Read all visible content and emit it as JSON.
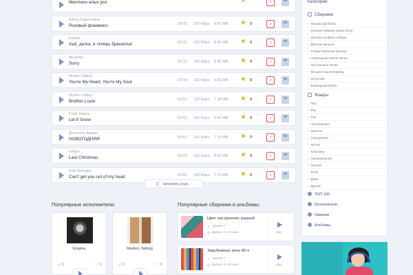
{
  "tracks": [
    {
      "artist": "",
      "title": "Меллион алых роз",
      "duration": "",
      "bitrate": "",
      "size": "",
      "likes": ""
    },
    {
      "artist": "Алина Самсоновна",
      "title": "Розовый фламинго",
      "duration": "38:08",
      "bitrate": "192 Kbps",
      "size": "8.82 MB",
      "likes": "0"
    },
    {
      "artist": "Комбат",
      "title": "Хей, детка, я теперь брюнетка!",
      "duration": "03:31",
      "bitrate": "192 Kbps",
      "size": "8.82 MB",
      "likes": "0"
    },
    {
      "artist": "Monsoha",
      "title": "Sorry",
      "duration": "03:31",
      "bitrate": "192 Kbps",
      "size": "8.82 MB",
      "likes": "0"
    },
    {
      "artist": "Modern Talking",
      "title": "You're My Heart, You're My Soul",
      "duration": "03:09",
      "bitrate": "192 Kbps",
      "size": "8.82 MB",
      "likes": "0"
    },
    {
      "artist": "Modern Talking",
      "title": "Brother Louie",
      "duration": "03:51",
      "bitrate": "192 Kbps",
      "size": "7.34 MB",
      "likes": "0"
    },
    {
      "artist": "Frank Sinatra",
      "title": "Let It Snow",
      "duration": "03:51",
      "bitrate": "192 Kbps",
      "size": "6.90 MB",
      "likes": "0"
    },
    {
      "artist": "Дискотека Авария",
      "title": "НОВОГОДНЯЯ",
      "duration": "03:51",
      "bitrate": "192 Kbps",
      "size": "7.76 MB",
      "likes": "0"
    },
    {
      "artist": "Wham!",
      "title": "Last Christmas",
      "duration": "03:09",
      "bitrate": "192 Kbps",
      "size": "8.82 MB",
      "likes": "0"
    },
    {
      "artist": "Kelly Mehugue",
      "title": "Can't get you out of my head",
      "duration": "03:51",
      "bitrate": "192 Kbps",
      "size": "7.76 MB",
      "likes": "0"
    }
  ],
  "load_more": "загрузить еще...",
  "artists_heading": "Популярные исполнители:",
  "collections_heading": "Популярные сборники и альбомы:",
  "artists": [
    {
      "name": "Enigma",
      "tracks": "3",
      "likes": "0"
    },
    {
      "name": "Modern Talking",
      "tracks": "3",
      "likes": "0"
    }
  ],
  "collections": [
    {
      "title": "Цвет настроения: разный",
      "count": "треков: 7",
      "duration": "время: 0ч 16 мин",
      "play": "play"
    },
    {
      "title": "Зарубежные хиты 80-х",
      "count": "треков: 7",
      "duration": "время: 0ч 16 мин",
      "play": "play"
    }
  ],
  "sidebar": {
    "top_label": "Категории",
    "collections_label": "Сборники",
    "collections": [
      "Музыка футбола",
      "Лучшие новинки музон 2018",
      "Музыка на День победы",
      "Детская музыка",
      "Рождественская музыка",
      "Новогодние клипы песни",
      "Застольные песни",
      "Музыка под вечеринку",
      "За рулем",
      "Баннерный вовон"
    ],
    "genres_label": "Жанры",
    "genres": [
      "Поп",
      "Рок",
      "Рэп",
      "Электроника",
      "Шансон",
      "Саундтреки",
      "Метал",
      "Классика",
      "Танцевальная",
      "Лесная",
      "R'n'B",
      "Джаз",
      "Другие"
    ],
    "links": [
      "ТОП 100",
      "Исполнители",
      "Новинки",
      "Альбомы"
    ]
  },
  "colors": {
    "accent": "#7c93c9",
    "star": "#d9b23a",
    "ringtone": "#e04a5c"
  }
}
